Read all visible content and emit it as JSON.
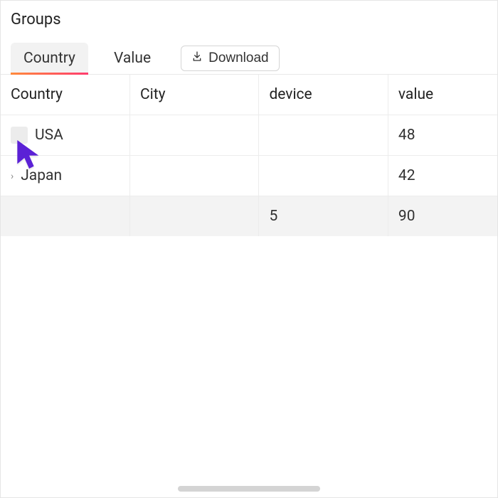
{
  "title": "Groups",
  "tabs": [
    {
      "label": "Country",
      "active": true
    },
    {
      "label": "Value",
      "active": false
    }
  ],
  "download_label": "Download",
  "columns": [
    "Country",
    "City",
    "device",
    "value"
  ],
  "rows": [
    {
      "country": "USA",
      "city": "",
      "device": "",
      "value": "48",
      "expand": "box"
    },
    {
      "country": "Japan",
      "city": "",
      "device": "",
      "value": "42",
      "expand": "chevron"
    },
    {
      "country": "",
      "city": "",
      "device": "5",
      "value": "90",
      "expand": "none",
      "summary": true
    }
  ]
}
